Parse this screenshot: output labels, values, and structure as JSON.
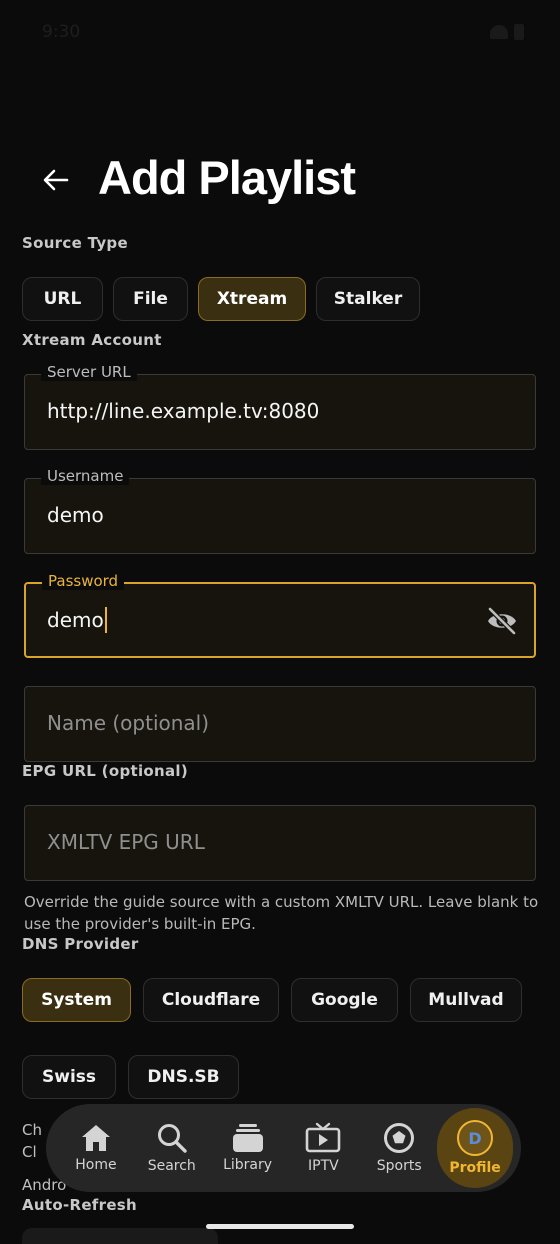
{
  "status_bar": {
    "time": "9:30"
  },
  "header": {
    "title": "Add Playlist"
  },
  "source_type": {
    "label": "Source Type",
    "options": [
      "URL",
      "File",
      "Xtream",
      "Stalker"
    ],
    "selected": "Xtream"
  },
  "xtream": {
    "label": "Xtream Account",
    "server_url": {
      "label": "Server URL",
      "value": "http://line.example.tv:8080"
    },
    "username": {
      "label": "Username",
      "value": "demo"
    },
    "password": {
      "label": "Password",
      "value": "demo"
    },
    "name": {
      "placeholder": "Name (optional)"
    }
  },
  "epg": {
    "label": "EPG URL (optional)",
    "placeholder": "XMLTV EPG URL",
    "helper": "Override the guide source with a custom XMLTV URL. Leave blank to use the provider's built-in EPG."
  },
  "dns": {
    "label": "DNS Provider",
    "row1": [
      "System",
      "Cloudflare",
      "Google",
      "Mullvad"
    ],
    "row2": [
      "Swiss",
      "DNS.SB"
    ],
    "selected": "System",
    "partial_line1": "Ch",
    "partial_line2": "Cl",
    "partial_line3": "Andro"
  },
  "auto_refresh": {
    "label": "Auto-Refresh"
  },
  "nav": {
    "items": [
      {
        "label": "Home",
        "icon": "home-icon"
      },
      {
        "label": "Search",
        "icon": "search-icon"
      },
      {
        "label": "Library",
        "icon": "library-icon"
      },
      {
        "label": "IPTV",
        "icon": "tv-icon"
      },
      {
        "label": "Sports",
        "icon": "sports-icon"
      },
      {
        "label": "Profile",
        "icon": "avatar",
        "avatar_letter": "D"
      }
    ],
    "active": "Profile"
  },
  "colors": {
    "accent": "#e9b43a",
    "background": "#0b0b0b",
    "selected_chip": "#3a2f10"
  }
}
